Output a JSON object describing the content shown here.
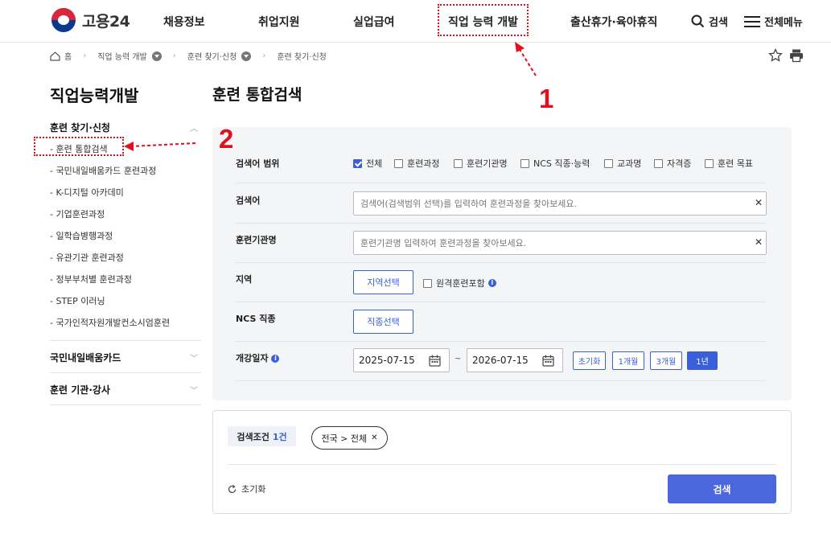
{
  "header": {
    "logo_text": "고용24",
    "nav": [
      "채용정보",
      "취업지원",
      "실업급여",
      "직업 능력 개발",
      "출산휴가·육아휴직"
    ],
    "search_label": "검색",
    "menu_label": "전체메뉴"
  },
  "breadcrumb": [
    "홈",
    "직업 능력 개발",
    "훈련 찾기·신청",
    "훈련 찾기·신청"
  ],
  "sidebar": {
    "title": "직업능력개발",
    "group1": "훈련 찾기·신청",
    "items": [
      "- 훈련 통합검색",
      "- 국민내일배움카드 훈련과정",
      "- K-디지털 아카데미",
      "- 기업훈련과정",
      "- 일학습병행과정",
      "- 유관기관 훈련과정",
      "- 정부부처별 훈련과정",
      "- STEP 이러닝",
      "- 국가인적자원개발컨소시엄훈련"
    ],
    "group2": "국민내일배움카드",
    "group3": "훈련 기관·강사"
  },
  "main": {
    "title": "훈련 통합검색",
    "scope_label": "검색어 범위",
    "scope_options": [
      "전체",
      "훈련과정",
      "훈련기관명",
      "NCS 직종·능력",
      "교과명",
      "자격증",
      "훈련 목표"
    ],
    "keyword_label": "검색어",
    "keyword_placeholder": "검색어(검색범위 선택)를 입력하여 훈련과정을 찾아보세요.",
    "org_label": "훈련기관명",
    "org_placeholder": "훈련기관명 입력하여 훈련과정을 찾아보세요.",
    "region_label": "지역",
    "region_button": "지역선택",
    "remote_label": "원격훈련포함",
    "ncs_label": "NCS 직종",
    "ncs_button": "직종선택",
    "date_label": "개강일자",
    "date_from": "2025-07-15",
    "date_to": "2026-07-15",
    "date_sep": "~",
    "period_chips": [
      "초기화",
      "1개월",
      "3개월",
      "1년"
    ],
    "selected_period": "1년"
  },
  "conditions": {
    "label": "검색조건",
    "count": "1건",
    "tag": "전국 > 전체",
    "reset": "초기화",
    "search_button": "검색"
  },
  "annotations": {
    "num1": "1",
    "num2": "2",
    "color": "#e0101c"
  },
  "colors": {
    "accent": "#3a5fd8",
    "search_button": "#4a67de"
  }
}
